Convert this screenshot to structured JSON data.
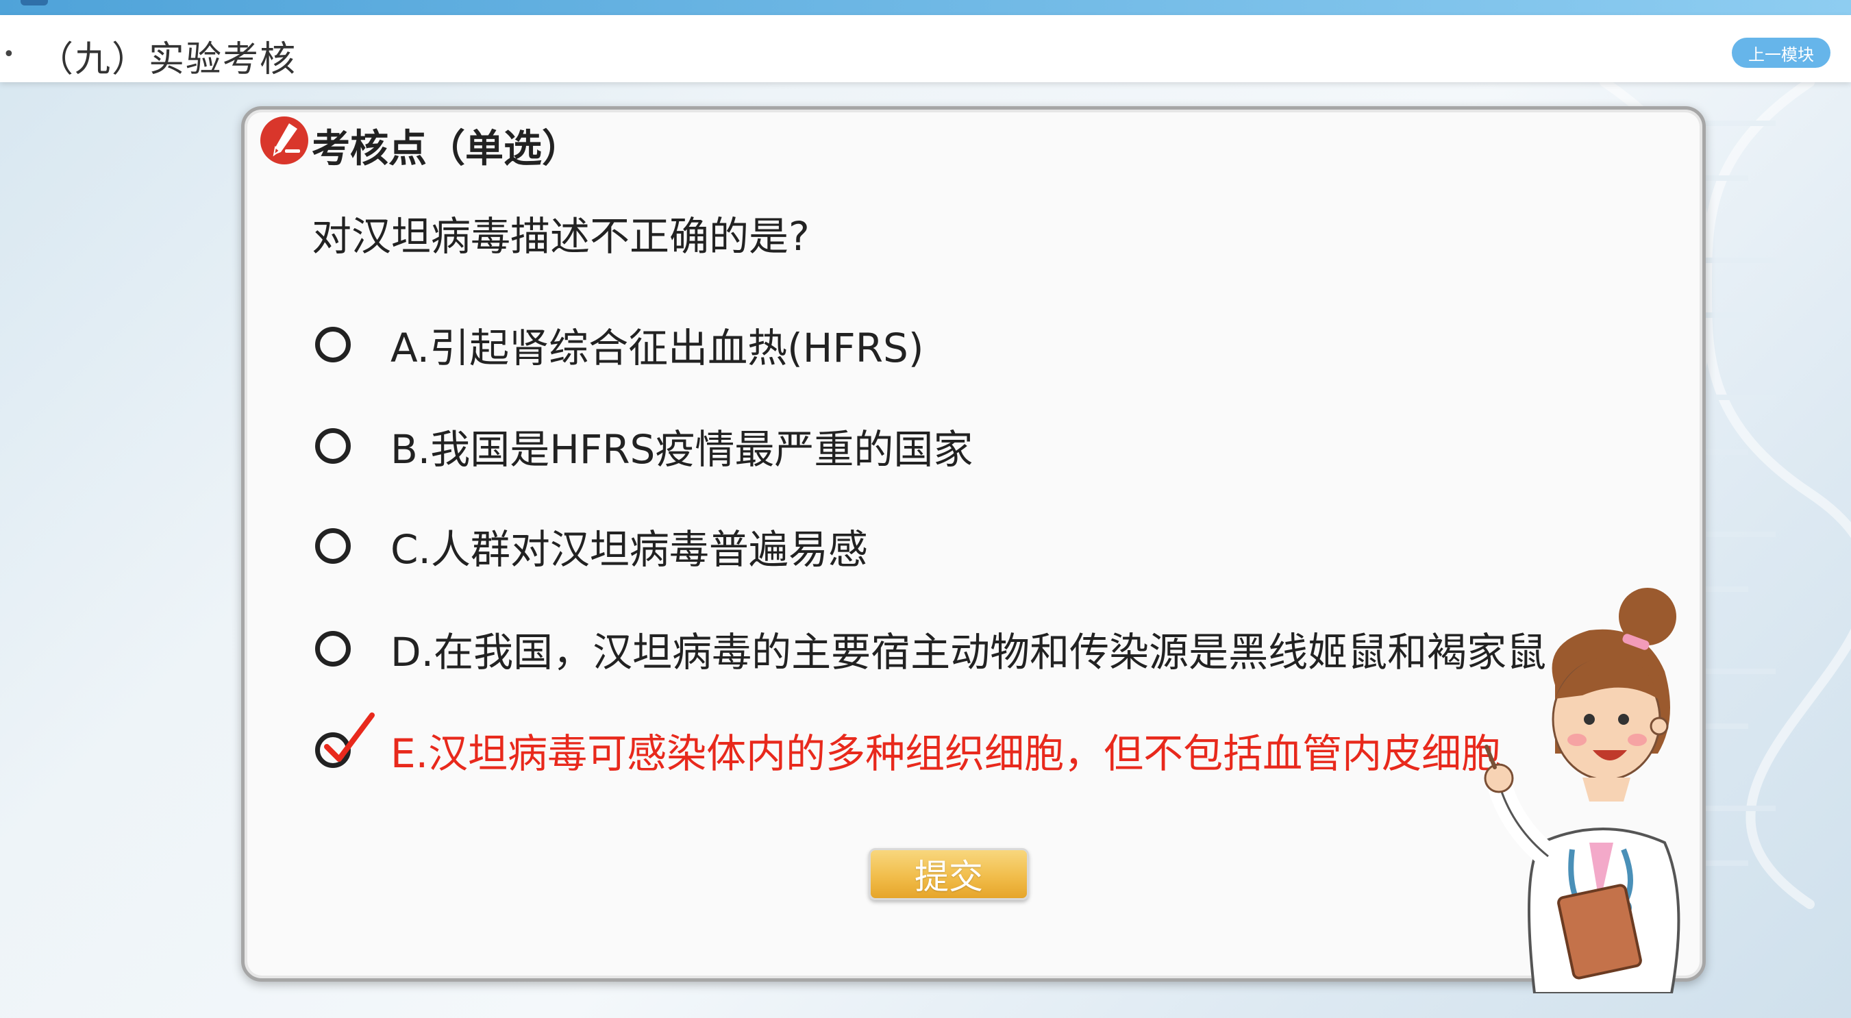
{
  "header": {
    "bullet": "•",
    "title": "（九）实验考核",
    "prev_button": "上一模块"
  },
  "quiz": {
    "heading": "考核点（单选）",
    "question": "对汉坦病毒描述不正确的是?",
    "options": [
      {
        "label": "A.引起肾综合征出血热(HFRS)",
        "selected": false
      },
      {
        "label": "B.我国是HFRS疫情最严重的国家",
        "selected": false
      },
      {
        "label": "C.人群对汉坦病毒普遍易感",
        "selected": false
      },
      {
        "label": "D.在我国，汉坦病毒的主要宿主动物和传染源是黑线姬鼠和褐家鼠",
        "selected": false
      },
      {
        "label": "E.汉坦病毒可感染体内的多种组织细胞，但不包括血管内皮细胞",
        "selected": true
      }
    ],
    "submit_label": "提交"
  },
  "icons": {
    "badge": "pencil-badge-icon",
    "radio": "radio-icon",
    "check": "checkmark-icon",
    "mascot": "doctor-mascot-icon"
  },
  "colors": {
    "accent_red": "#e8291c",
    "badge_red": "#d9362b",
    "header_blue": "#66b5ea",
    "submit_gold": "#f1bd4b"
  }
}
